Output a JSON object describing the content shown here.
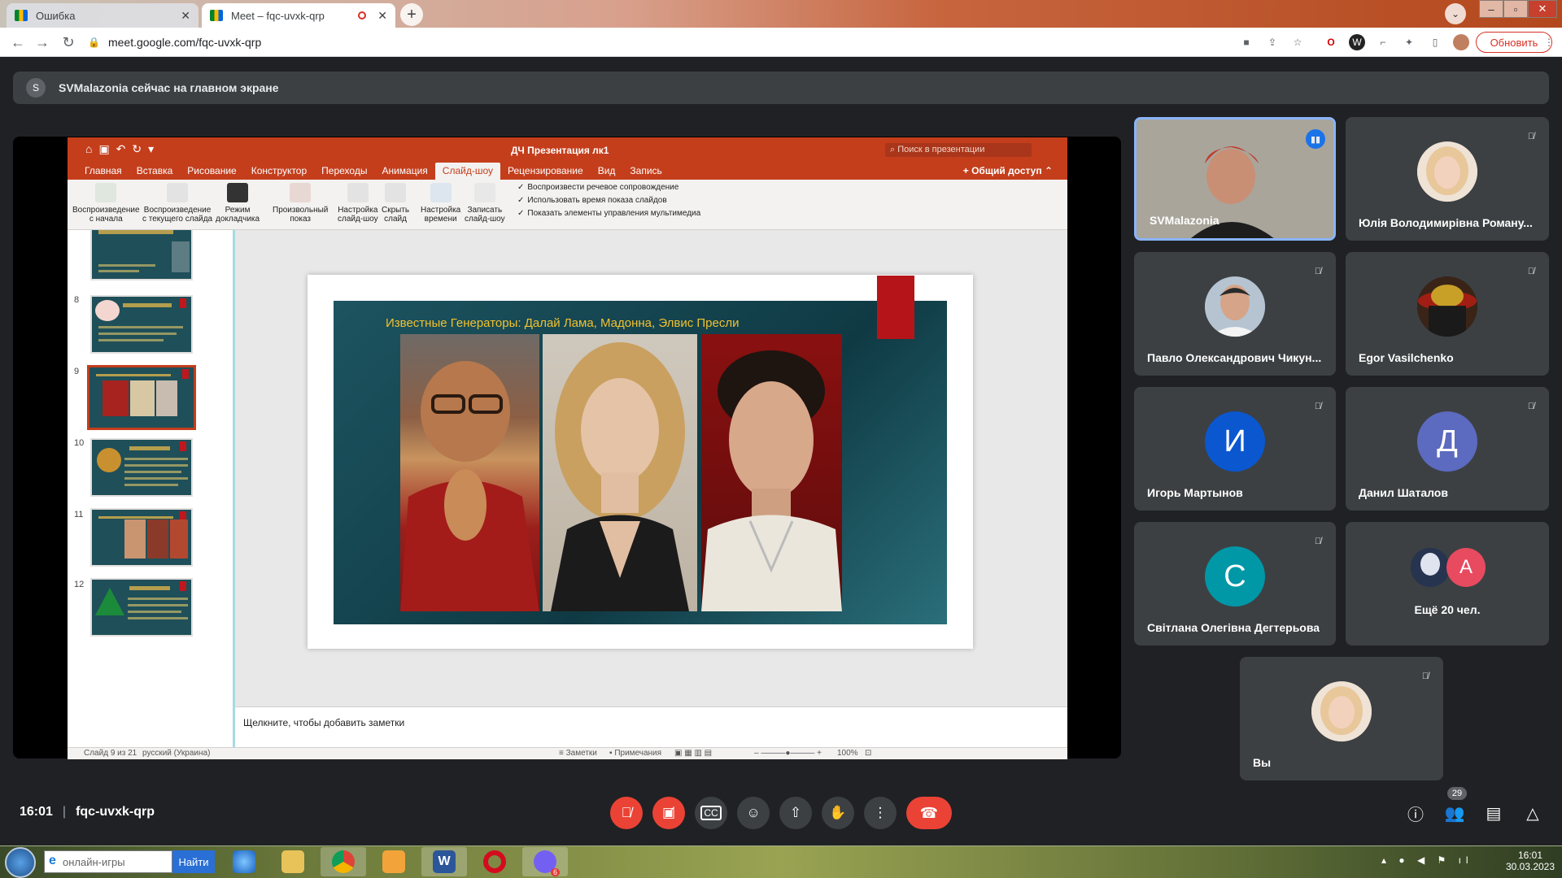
{
  "browser": {
    "tabs": [
      {
        "title": "Ошибка"
      },
      {
        "title": "Meet – fqc-uvxk-qrp"
      }
    ],
    "url": "meet.google.com/fqc-uvxk-qrp",
    "update_label": "Обновить"
  },
  "banner": {
    "avatar_letter": "S",
    "text": "SVMalazonia сейчас на главном экране"
  },
  "powerpoint": {
    "doc_title": "ДЧ Презентация лк1",
    "search_placeholder": "Поиск в презентации",
    "tabs": [
      "Главная",
      "Вставка",
      "Рисование",
      "Конструктор",
      "Переходы",
      "Анимация",
      "Слайд-шоу",
      "Рецензирование",
      "Вид",
      "Запись"
    ],
    "active_tab": "Слайд-шоу",
    "share_label": "Общий доступ",
    "ribbon_buttons": [
      {
        "label1": "Воспроизведение",
        "label2": "с начала"
      },
      {
        "label1": "Воспроизведение",
        "label2": "с текущего слайда"
      },
      {
        "label1": "Режим",
        "label2": "докладчика"
      },
      {
        "label1": "Произвольный",
        "label2": "показ"
      },
      {
        "label1": "Настройка",
        "label2": "слайд-шоу"
      },
      {
        "label1": "Скрыть",
        "label2": "слайд"
      },
      {
        "label1": "Настройка",
        "label2": "времени"
      },
      {
        "label1": "Записать",
        "label2": "слайд-шоу"
      }
    ],
    "checkboxes": [
      "Воспроизвести речевое сопровождение",
      "Использовать время показа слайдов",
      "Показать элементы управления мультимедиа"
    ],
    "slide_numbers": [
      "8",
      "9",
      "10",
      "11",
      "12"
    ],
    "slide_title": "Известные Генераторы: Далай Лама, Мадонна, Элвис Пресли",
    "notes_placeholder": "Щелкните, чтобы добавить заметки",
    "status": {
      "slide_counter": "Слайд 9 из 21",
      "language": "русский (Украина)",
      "notes": "Заметки",
      "comments": "Примечания",
      "zoom": "100%"
    }
  },
  "participants": [
    {
      "name": "SVMalazonia",
      "speaking": true
    },
    {
      "name": "Юлія Володимирівна Роману..."
    },
    {
      "name": "Павло Олександрович Чикун..."
    },
    {
      "name": "Egor Vasilchenko"
    },
    {
      "name": "Игорь Мартынов",
      "letter": "И",
      "color": "#0b57d0"
    },
    {
      "name": "Данил Шаталов",
      "letter": "Д",
      "color": "#5c6bc0"
    },
    {
      "name": "Світлана Олегівна Дегтерьова",
      "letter": "С",
      "color": "#0097a7"
    },
    {
      "name": "Ещё 20 чел.",
      "letter": "A",
      "color": "#e84a5f"
    },
    {
      "name": "Вы"
    }
  ],
  "meeting": {
    "time": "16:01",
    "code": "fqc-uvxk-qrp",
    "people_count": "29"
  },
  "taskbar": {
    "search_placeholder": "онлайн-игры",
    "search_button": "Найти",
    "viber_badge": "6",
    "time": "16:01",
    "date": "30.03.2023"
  },
  "colors": {
    "meet_bg": "#202124",
    "tile_bg": "#3c4043",
    "danger": "#ea4335",
    "ppt_accent": "#c43e1c",
    "slide_teal": "#1c5460"
  }
}
